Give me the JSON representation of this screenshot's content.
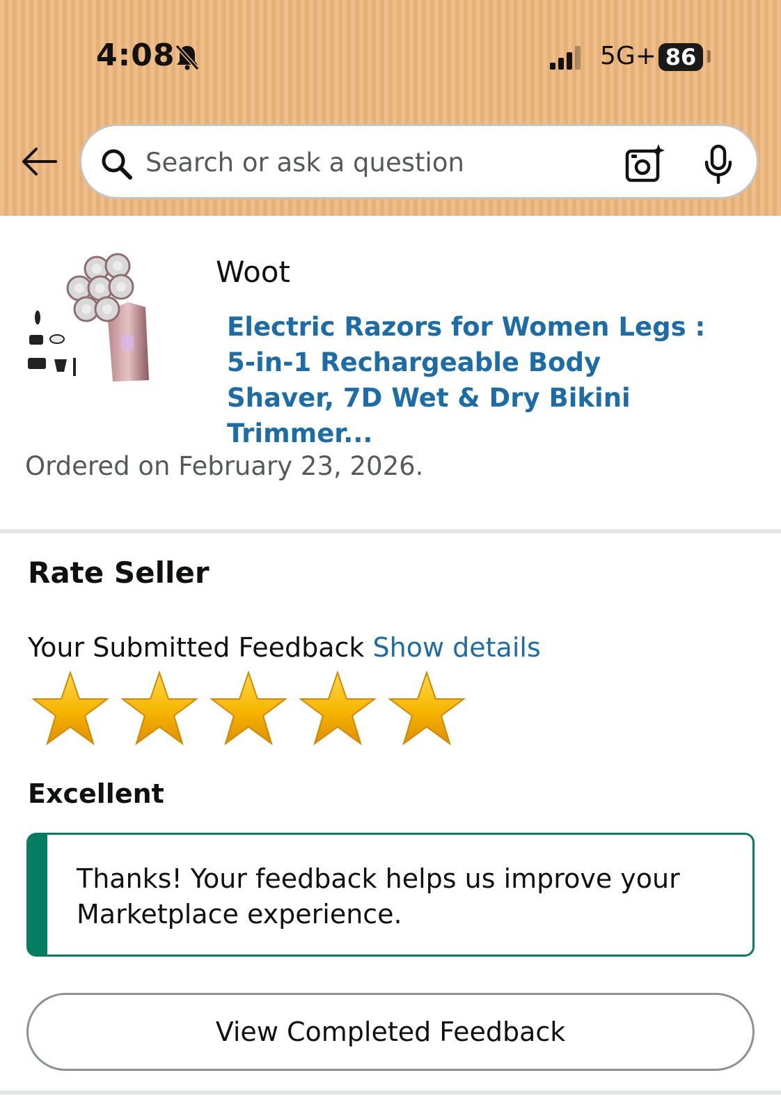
{
  "status_bar": {
    "time": "4:08",
    "network": "5G+",
    "battery": "86"
  },
  "search": {
    "placeholder": "Search or ask a question",
    "value": ""
  },
  "icons": {
    "back": "back-arrow-icon",
    "bell_muted": "bell-slash-icon",
    "signal": "signal-bars-icon",
    "search": "search-icon",
    "camera": "camera-sparkle-icon",
    "mic": "microphone-icon"
  },
  "order": {
    "seller": "Woot",
    "product_title": "Electric Razors for Women Legs : 5-in-1 Rechargeable Body Shaver, 7D Wet & Dry Bikini Trimmer...",
    "ordered_text": "Ordered on February 23, 2026."
  },
  "rate_seller": {
    "heading": "Rate Seller",
    "submitted_label": "Your Submitted Feedback",
    "show_details": "Show details",
    "rating": 5,
    "rating_max": 5,
    "rating_text": "Excellent",
    "alert_text": "Thanks! Your feedback helps us improve your Marketplace experience.",
    "view_button": "View Completed Feedback"
  },
  "colors": {
    "header_bg": "#ecb77d",
    "link": "#1c6ca8",
    "success": "#067d62",
    "star": "#f7b500"
  }
}
